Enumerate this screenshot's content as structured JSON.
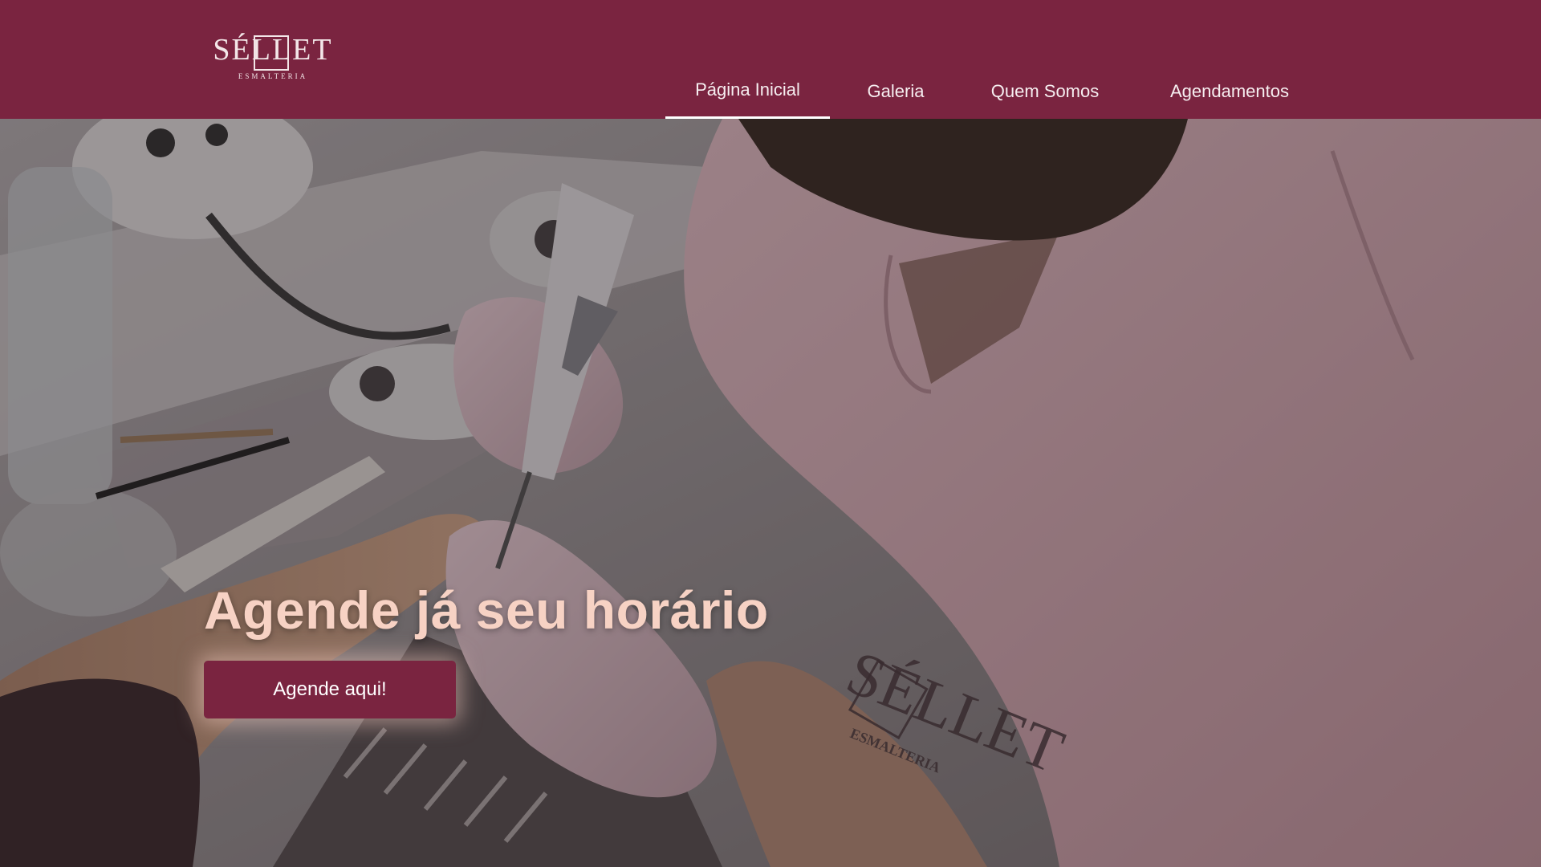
{
  "header": {
    "logo": {
      "wordmark": "SÉLLET",
      "subtitle": "ESMALTERIA"
    },
    "nav": [
      {
        "label": "Página Inicial",
        "active": true
      },
      {
        "label": "Galeria",
        "active": false
      },
      {
        "label": "Quem Somos",
        "active": false
      },
      {
        "label": "Agendamentos",
        "active": false
      }
    ]
  },
  "hero": {
    "heading": "Agende já seu horário",
    "cta_label": "Agende aqui!",
    "background_image": "manicurist-filing-nails-photo",
    "shirt_logo": {
      "wordmark": "SÉLLET",
      "subtitle": "ESMALTERIA"
    }
  },
  "colors": {
    "brand": "#7a2440",
    "heading": "#f7d2c4",
    "nav_text": "#f6eef0"
  }
}
